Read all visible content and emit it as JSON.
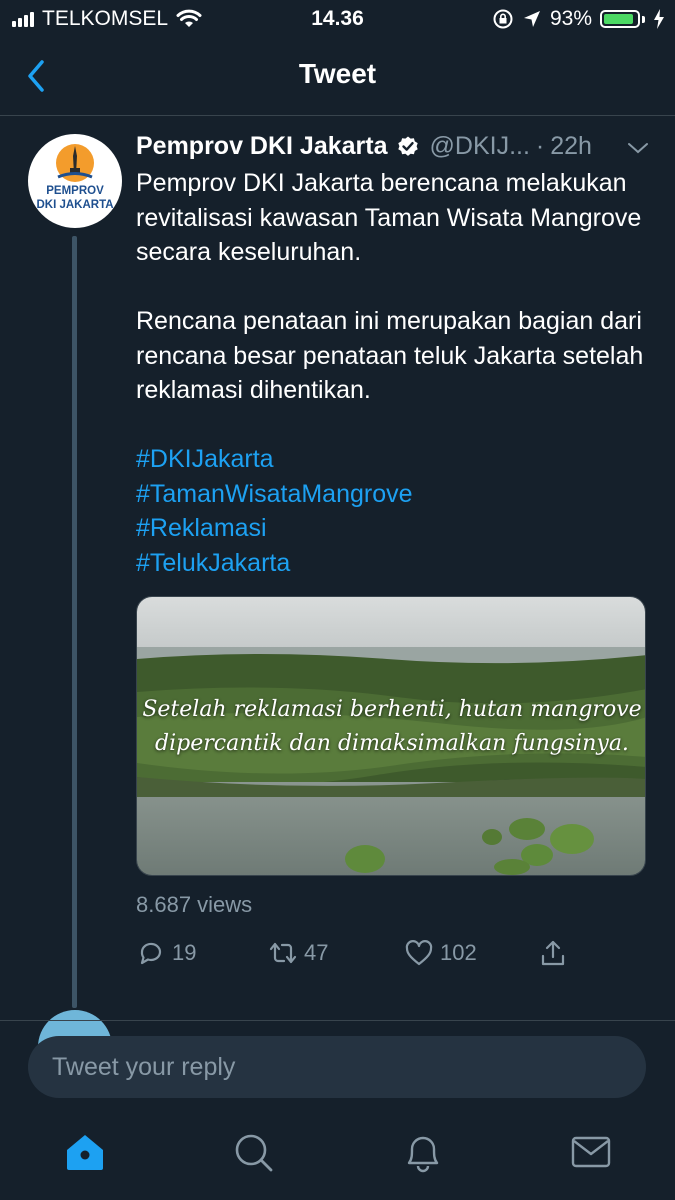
{
  "status_bar": {
    "carrier": "TELKOMSEL",
    "time": "14.36",
    "battery_percent": "93%",
    "battery_level": 0.93
  },
  "header": {
    "title": "Tweet"
  },
  "tweet": {
    "author_name": "Pemprov DKI Jakarta",
    "handle": "@DKIJ...",
    "separator": "·",
    "age": "22h",
    "avatar_text_line1": "PEMPROV",
    "avatar_text_line2": "DKI JAKARTA",
    "paragraph1": "Pemprov DKI Jakarta berencana melakukan revitalisasi kawasan Taman Wisata Mangrove secara keseluruhan.",
    "paragraph2": "Rencana penataan ini merupakan bagian dari rencana besar penataan teluk Jakarta setelah reklamasi dihentikan.",
    "hashtags": [
      "#DKIJakarta",
      "#TamanWisataMangrove",
      "#Reklamasi",
      "#TelukJakarta"
    ],
    "media_caption_line1": "Setelah reklamasi berhenti, hutan mangrove",
    "media_caption_line2": "dipercantik dan dimaksimalkan fungsinya.",
    "views": "8.687 views",
    "replies": "19",
    "retweets": "47",
    "likes": "102"
  },
  "reply": {
    "placeholder": "Tweet your reply"
  },
  "colors": {
    "background": "#15202b",
    "accent": "#1da1f2",
    "muted": "#8899a6"
  },
  "icons": [
    "back-chevron-icon",
    "verified-badge-icon",
    "chevron-down-icon",
    "reply-icon",
    "retweet-icon",
    "like-icon",
    "share-icon",
    "home-icon",
    "search-icon",
    "notifications-icon",
    "messages-icon"
  ]
}
